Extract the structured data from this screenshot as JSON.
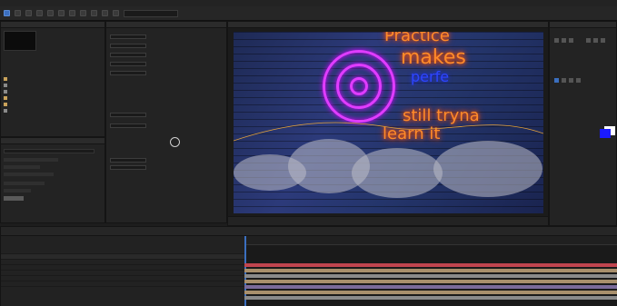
{
  "comp_text": {
    "line1": "Practice",
    "line2": "makes",
    "line3": "perfe",
    "line4": "still tryna",
    "line5": "learn it"
  },
  "colors": {
    "neon_orange": "#ff8a2a",
    "neon_blue": "#2d45ff",
    "neon_pink": "#e03cff",
    "accent": "#3b6fbf",
    "timeline_bar_red": "#c0454f",
    "timeline_bar_tan": "#a88f6c",
    "timeline_bar_gray": "#8a8a8a",
    "timeline_bar_purple": "#7a6a9a"
  },
  "icons": [
    "selection-tool-icon",
    "hand-tool-icon",
    "zoom-tool-icon",
    "rotate-tool-icon",
    "camera-tool-icon",
    "pen-tool-icon",
    "text-tool-icon",
    "brush-tool-icon"
  ]
}
